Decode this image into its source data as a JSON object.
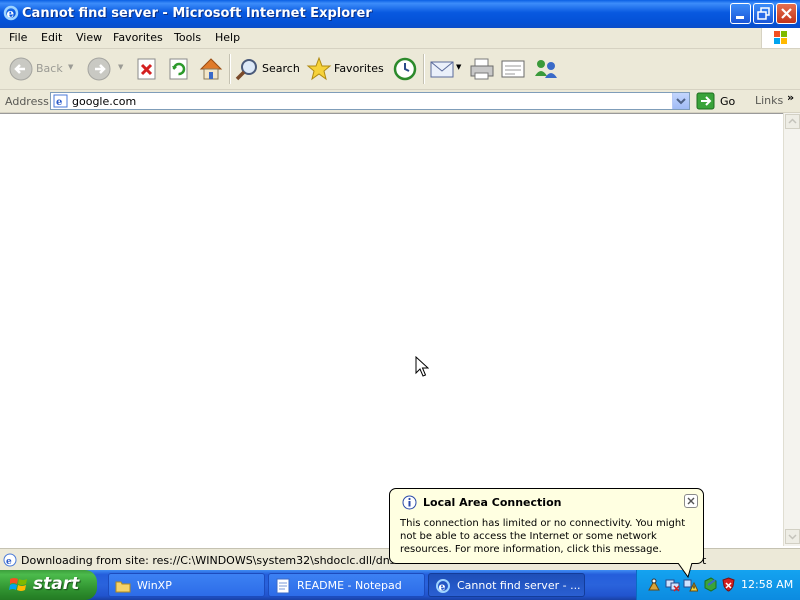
{
  "window": {
    "title": "Cannot find server - Microsoft Internet Explorer"
  },
  "menu": {
    "items": [
      "File",
      "Edit",
      "View",
      "Favorites",
      "Tools",
      "Help"
    ]
  },
  "toolbar": {
    "back_label": "Back",
    "search_label": "Search",
    "favorites_label": "Favorites"
  },
  "address": {
    "label": "Address",
    "url": "google.com",
    "go_label": "Go",
    "links_label": "Links",
    "links_chevron": "»"
  },
  "status": {
    "text": "Downloading from site: res://C:\\WINDOWS\\system32\\shdoclc.dll/dnserror.ht",
    "zone_tail": "t"
  },
  "balloon": {
    "title": "Local Area Connection",
    "message": "This connection has limited or no connectivity. You might not be able to access the Internet or some network resources. For more information, click this message."
  },
  "taskbar": {
    "start_label": "start",
    "tasks": [
      {
        "label": "WinXP",
        "icon": "folder-icon"
      },
      {
        "label": "README - Notepad",
        "icon": "notepad-icon"
      },
      {
        "label": "Cannot find server - ...",
        "icon": "internet-explorer-icon",
        "active": true
      }
    ],
    "clock": "12:58 AM"
  },
  "colors": {
    "titlebar_blue": "#0859e0",
    "taskbar_blue": "#245edb",
    "start_green": "#3c9e3c",
    "chrome_beige": "#ece9d8",
    "balloon_yellow": "#ffffe1"
  }
}
